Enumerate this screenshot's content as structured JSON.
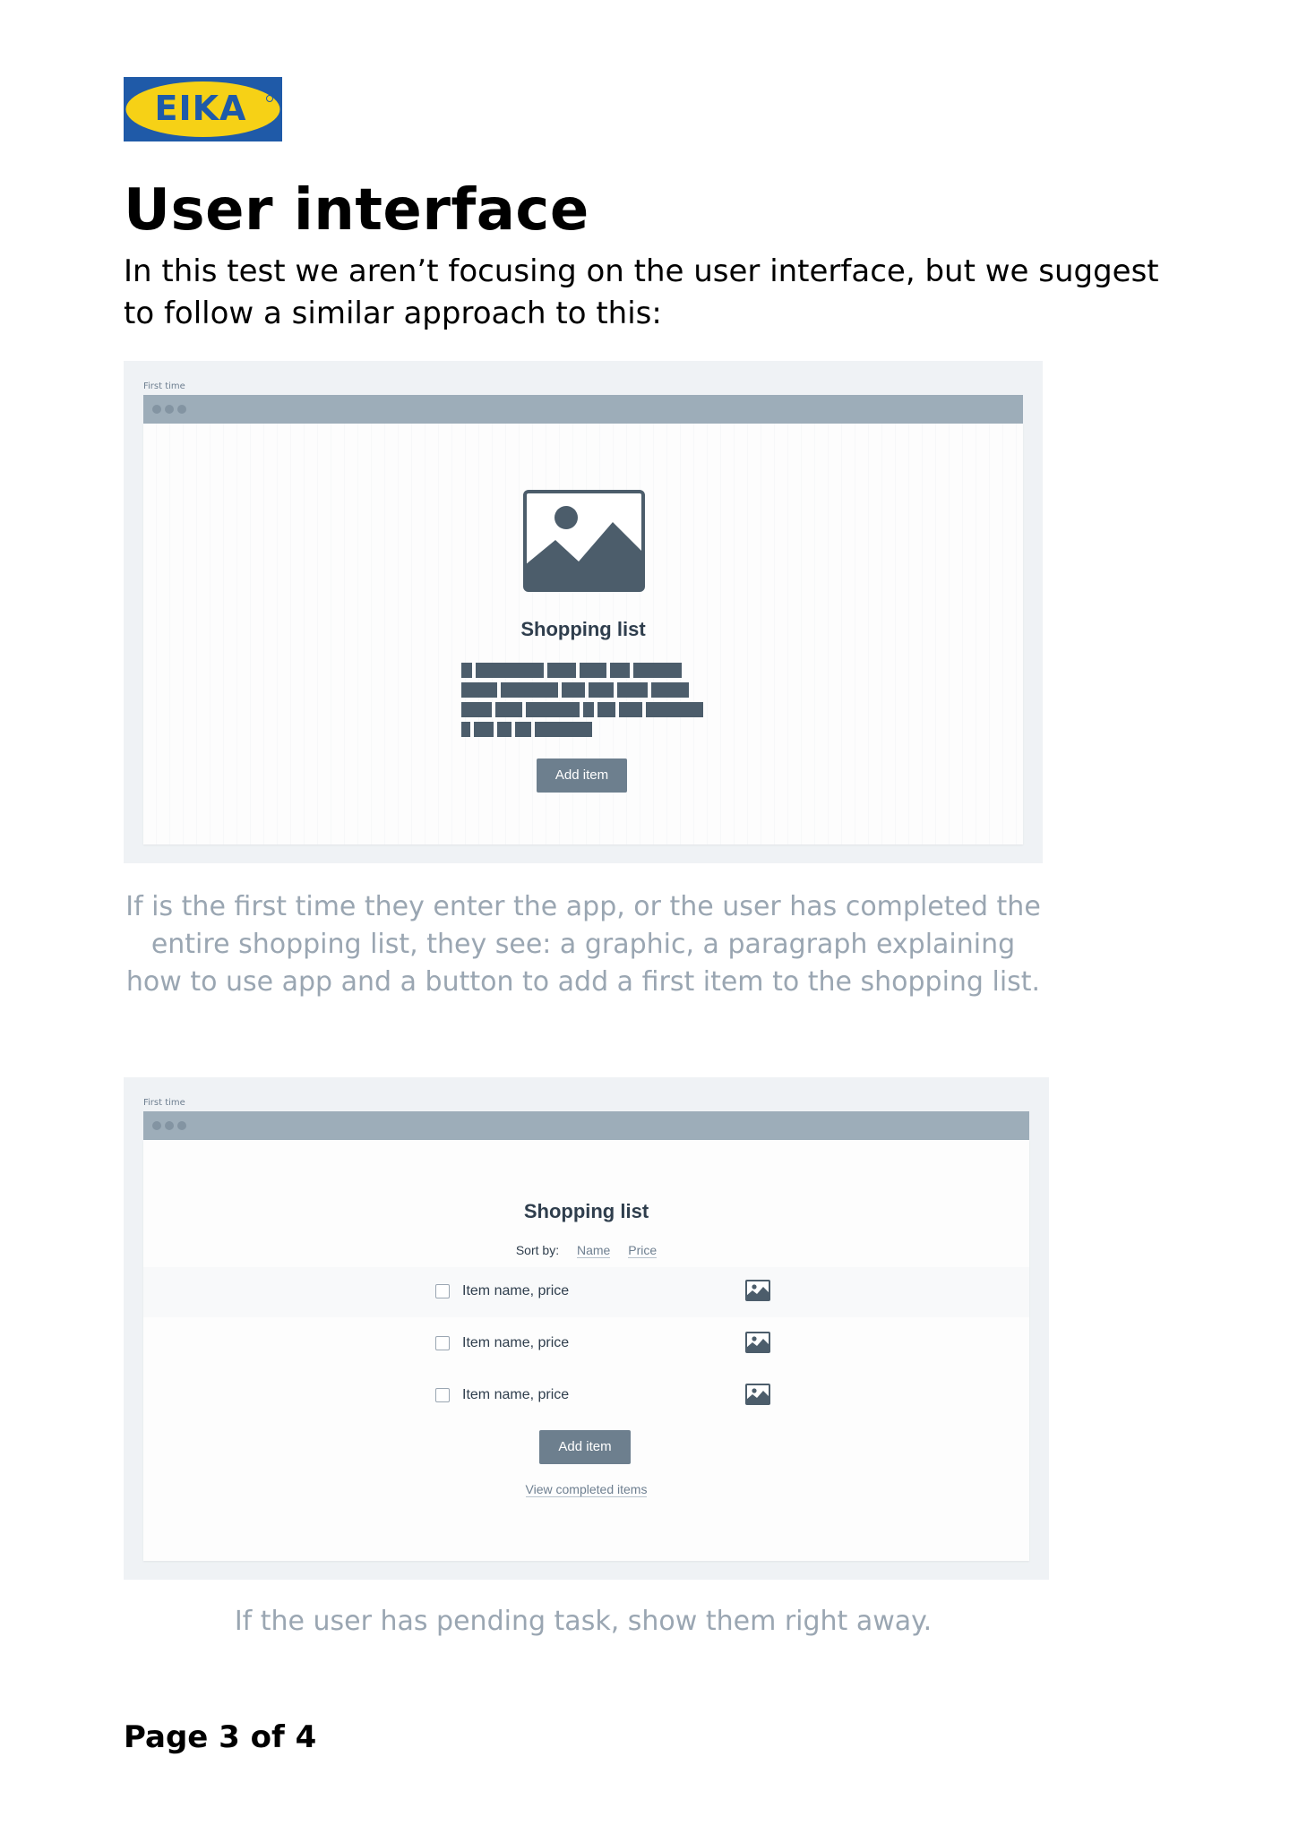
{
  "brand": {
    "logo_text": "EIKA",
    "logo_bg": "#1f5aa8",
    "logo_ellipse": "#f6d116"
  },
  "page": {
    "title": "User interface",
    "intro": "In this test we aren’t focusing on the user interface, but we suggest to follow a similar approach to this:",
    "footer": "Page 3 of 4"
  },
  "mockup_empty": {
    "label": "First time",
    "image_icon": "image-placeholder-icon",
    "title": "Shopping list",
    "button_label": "Add  item",
    "caption": "If is the first time they enter the app, or the user has completed the entire shopping list, they see: a graphic, a paragraph explaining how to use app and a button to add a first item to the shopping list."
  },
  "mockup_list": {
    "label": "First time",
    "title": "Shopping list",
    "sort_label": "Sort by:",
    "sort_options": [
      "Name",
      "Price"
    ],
    "items": [
      {
        "label": "Item name, price",
        "icon": "image-thumbnail-icon"
      },
      {
        "label": "Item name, price",
        "icon": "image-thumbnail-icon"
      },
      {
        "label": "Item name, price",
        "icon": "image-thumbnail-icon"
      }
    ],
    "button_label": "Add  item",
    "view_completed": "View completed items",
    "caption": "If the user has pending task, show them right away."
  },
  "colors": {
    "frame_bg": "#eff2f5",
    "window_bar": "#9dadb9",
    "button_bg": "#6d7f8e",
    "dark_slate": "#4c5d6b",
    "caption_gray": "#9aa6b2"
  }
}
